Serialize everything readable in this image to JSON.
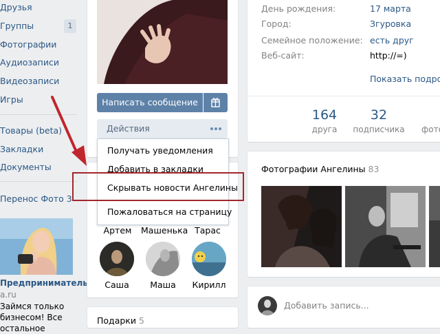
{
  "sidebar": {
    "items": [
      {
        "label": "Друзья"
      },
      {
        "label": "Группы",
        "count": "1"
      },
      {
        "label": "Фотографии"
      },
      {
        "label": "Аудиозаписи"
      },
      {
        "label": "Видеозаписи"
      },
      {
        "label": "Игры"
      },
      {
        "label": "Товары (beta)"
      },
      {
        "label": "Закладки"
      },
      {
        "label": "Документы"
      },
      {
        "label": "Перенос Фото 3"
      }
    ],
    "ad": {
      "title": "Предприниматель?",
      "domain": "a.ru",
      "text_line1": "Займся только",
      "text_line2": "бизнесом! Все остальное"
    }
  },
  "profile": {
    "write_button": "Написать сообщение",
    "actions_label": "Действия",
    "dropdown": [
      "Получать уведомления",
      "Добавить в закладки",
      "Скрывать новости Ангелины",
      "Пожаловаться на страницу"
    ]
  },
  "friends": {
    "top_names": [
      "Артем",
      "Машенька",
      "Тарас"
    ],
    "bottom_names": [
      "Саша",
      "Маша",
      "Кирилл"
    ]
  },
  "gifts": {
    "label": "Подарки",
    "count": "5"
  },
  "info": {
    "rows": [
      {
        "label": "День рождения:",
        "value": "17 марта"
      },
      {
        "label": "Город:",
        "value": "Згуровка"
      },
      {
        "label": "Семейное положение:",
        "value": "есть друг"
      },
      {
        "label": "Веб-сайт:",
        "value": "http://=)"
      }
    ],
    "show_more": "Показать подробную информацию"
  },
  "counters": [
    {
      "num": "164",
      "label": "друга"
    },
    {
      "num": "32",
      "label": "подписчика"
    },
    {
      "num": "",
      "label": "фото"
    }
  ],
  "photos": {
    "title": "Фотографии Ангелины",
    "count": "83"
  },
  "post": {
    "placeholder": "Добавить запись..."
  },
  "colors": {
    "link": "#2a5885",
    "button": "#5e81a8",
    "highlight": "#a1262b",
    "arrow": "#c0262d"
  }
}
